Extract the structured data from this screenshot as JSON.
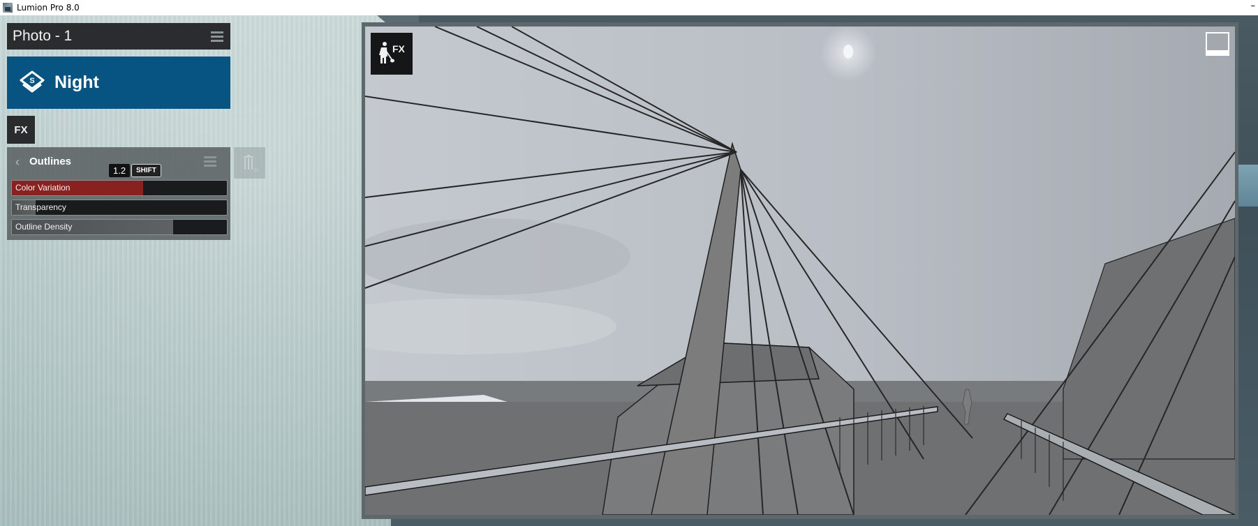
{
  "window": {
    "title": "Lumion Pro 8.0",
    "minimize_glyph": "–"
  },
  "photo": {
    "title": "Photo - 1",
    "menu_icon": "hamburger-menu-icon"
  },
  "style": {
    "label": "Night",
    "icon": "layered-style-icon"
  },
  "fx_button": {
    "label": "FX"
  },
  "effect": {
    "title": "Outlines",
    "back_glyph": "‹",
    "value_tooltip": "1.2",
    "modifier_hint": "SHIFT",
    "sliders": [
      {
        "label": "Color Variation",
        "value_fraction": 0.61,
        "active": true
      },
      {
        "label": "Transparency",
        "value_fraction": 0.11,
        "active": false
      },
      {
        "label": "Outline Density",
        "value_fraction": 0.75,
        "active": false
      }
    ],
    "delete_button": {
      "icon": "trash-icon",
      "hint": "2x"
    }
  },
  "viewport": {
    "fx_badge": "FX",
    "fx_icon": "worker-shovel-icon",
    "fullscreen_icon": "fullscreen-icon"
  },
  "colors": {
    "style_banner": "#075483",
    "slider_active": "#8a2121",
    "panel_dark": "#2b2c2d"
  }
}
